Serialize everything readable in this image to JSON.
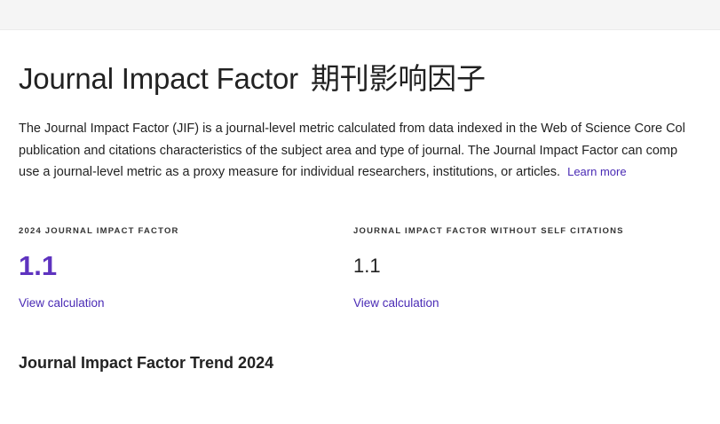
{
  "header": {
    "title": "Journal Impact Factor",
    "title_cn": "期刊影响因子"
  },
  "description": {
    "line1": "The Journal Impact Factor (JIF) is a journal-level metric calculated from data indexed in the Web of Science Core Col",
    "line2": "publication and citations characteristics of the subject area and type of journal. The Journal Impact Factor can comp",
    "line3": "use a journal-level metric as a proxy measure for individual researchers, institutions, or articles.",
    "learn_more": "Learn more"
  },
  "metrics": [
    {
      "label": "2024 JOURNAL IMPACT FACTOR",
      "value": "1.1",
      "link": "View calculation",
      "value_color": "#5e33bf"
    },
    {
      "label": "JOURNAL IMPACT FACTOR WITHOUT SELF CITATIONS",
      "value": "1.1",
      "link": "View calculation",
      "value_color": "#222222"
    }
  ],
  "trend": {
    "heading": "Journal Impact Factor Trend 2024"
  },
  "colors": {
    "accent": "#5e33bf",
    "link": "#4a2bb5",
    "top_bar": "#f5f5f5"
  }
}
